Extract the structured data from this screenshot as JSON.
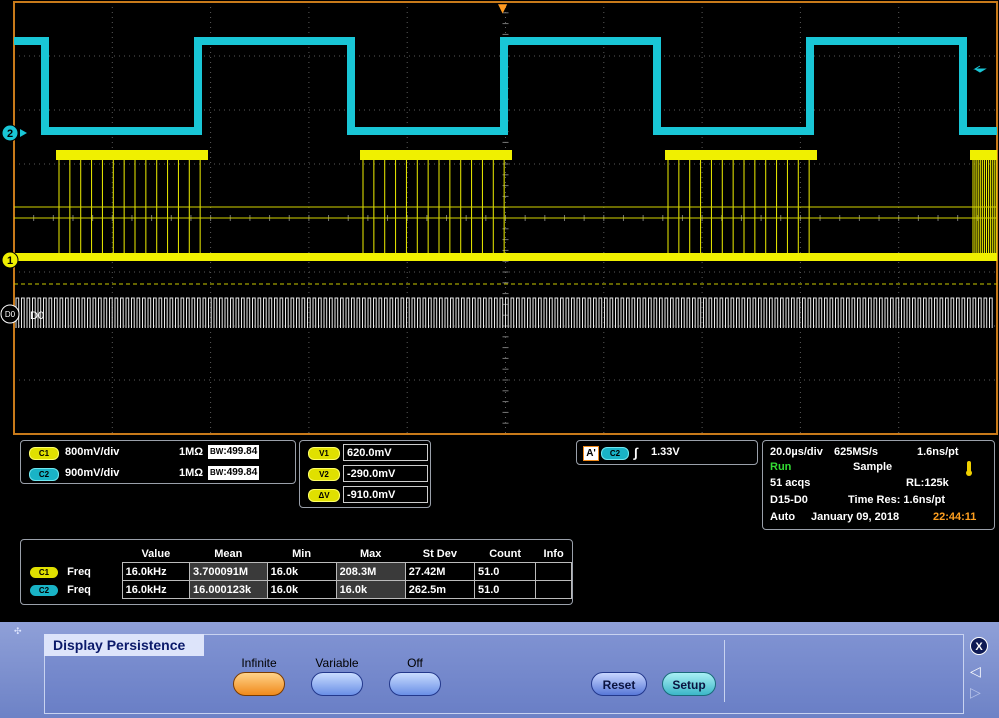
{
  "scope": {
    "ch2_marker": "2",
    "ch1_marker": "1",
    "d0_marker": "D0",
    "d0_label": "D0",
    "trigger_marker": "▼"
  },
  "channels": {
    "c1": {
      "tag": "C1",
      "scale": "800mV/div",
      "impedance": "1MΩ",
      "bw": "499.84",
      "bw_prefix": "B"
    },
    "c2": {
      "tag": "C2",
      "scale": "900mV/div",
      "impedance": "1MΩ",
      "bw": "499.84",
      "bw_prefix": "B"
    }
  },
  "cursors": {
    "v1_tag": "V1",
    "v1_value": "620.0mV",
    "v2_tag": "V2",
    "v2_value": "-290.0mV",
    "dv_tag": "ΔV",
    "dv_value": "-910.0mV"
  },
  "trigger": {
    "source_tag": "A'",
    "channel_tag": "C2",
    "slope_symbol": "∫",
    "level": "1.33V"
  },
  "acquisition": {
    "timebase": "20.0µs/div",
    "sample_rate": "625MS/s",
    "resolution": "1.6ns/pt",
    "state": "Run",
    "mode": "Sample",
    "acqs": "51 acqs",
    "record_length": "RL:125k",
    "digital": "D15-D0",
    "time_res": "Time Res: 1.6ns/pt",
    "trigger_mode": "Auto",
    "date": "January 09, 2018",
    "time": "22:44:11"
  },
  "measurements": {
    "headers": [
      "Value",
      "Mean",
      "Min",
      "Max",
      "St Dev",
      "Count",
      "Info"
    ],
    "rows": [
      {
        "tag": "C1",
        "name": "Freq",
        "value": "16.0kHz",
        "mean": "3.700091M",
        "min": "16.0k",
        "max": "208.3M",
        "stdev": "27.42M",
        "count": "51.0",
        "info": ""
      },
      {
        "tag": "C2",
        "name": "Freq",
        "value": "16.0kHz",
        "mean": "16.000123k",
        "min": "16.0k",
        "max": "16.0k",
        "stdev": "262.5m",
        "count": "51.0",
        "info": ""
      }
    ]
  },
  "menu": {
    "title": "Display Persistence",
    "options": [
      "Infinite",
      "Variable",
      "Off"
    ],
    "selected": "Infinite",
    "reset_label": "Reset",
    "setup_label": "Setup",
    "close_icon": "X"
  },
  "colors": {
    "ch1": "#f0f000",
    "ch2": "#19c6d6",
    "grid": "#5a5a5a",
    "frame": "#c87a1a",
    "time": "#ffa020",
    "run": "#33dd33"
  }
}
